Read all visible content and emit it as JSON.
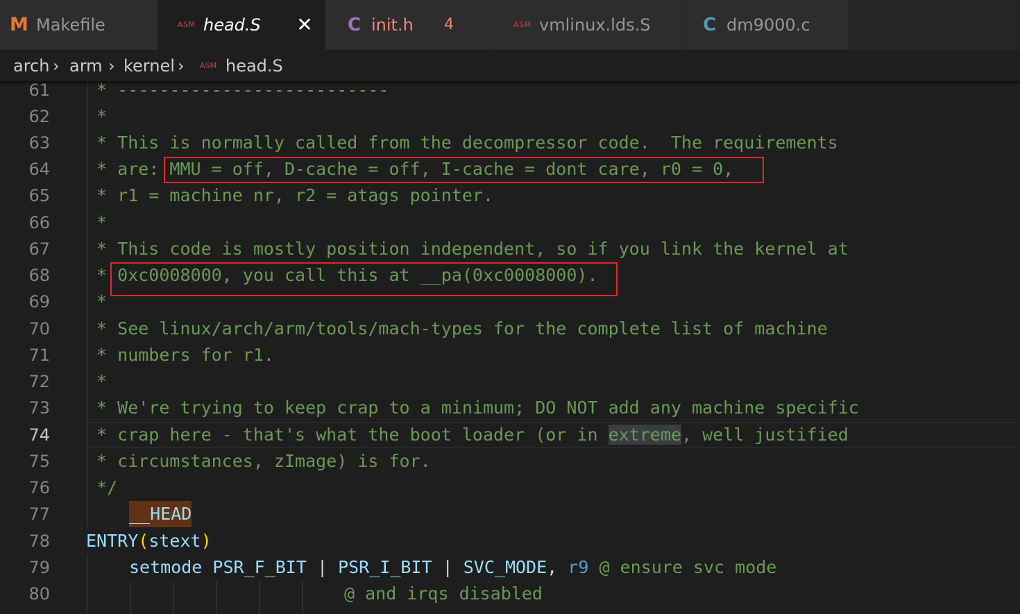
{
  "tabs": [
    {
      "icon": "M",
      "label": "Makefile"
    },
    {
      "icon": "ASM",
      "label": "head.S",
      "close": "✕"
    },
    {
      "icon": "C",
      "label": "init.h",
      "badge": "4"
    },
    {
      "icon": "ASM",
      "label": "vmlinux.lds.S"
    },
    {
      "icon": "C",
      "label": "dm9000.c"
    }
  ],
  "breadcrumb": {
    "parts": [
      "arch",
      "arm",
      "kernel"
    ],
    "file_icon": "ASM",
    "file": "head.S"
  },
  "editor": {
    "current_line": 74,
    "lines": [
      {
        "n": "61",
        "text": " * --------------------------"
      },
      {
        "n": "62",
        "text": " *"
      },
      {
        "n": "63",
        "text": " * This is normally called from the decompressor code.  The requirements"
      },
      {
        "n": "64",
        "text": " * are: MMU = off, D-cache = off, I-cache = dont care, r0 = 0,"
      },
      {
        "n": "65",
        "text": " * r1 = machine nr, r2 = atags pointer."
      },
      {
        "n": "66",
        "text": " *"
      },
      {
        "n": "67",
        "text": " * This code is mostly position independent, so if you link the kernel at"
      },
      {
        "n": "68",
        "text": " * 0xc0008000, you call this at __pa(0xc0008000)."
      },
      {
        "n": "69",
        "text": " *"
      },
      {
        "n": "70",
        "text": " * See linux/arch/arm/tools/mach-types for the complete list of machine"
      },
      {
        "n": "71",
        "text": " * numbers for r1."
      },
      {
        "n": "72",
        "text": " *"
      },
      {
        "n": "73",
        "text": " * We're trying to keep crap to a minimum; DO NOT add any machine specific"
      },
      {
        "n": "74",
        "text_pre": " * crap here - that's what the boot loader (or in ",
        "text_hl": "extreme",
        "text_post": ", well justified"
      },
      {
        "n": "75",
        "text": " * circumstances, zImage) is for."
      },
      {
        "n": "76",
        "text": " */"
      },
      {
        "n": "77",
        "text": "__HEAD"
      },
      {
        "n": "78",
        "entry": "ENTRY",
        "open": "(",
        "arg": "stext",
        "close": ")"
      },
      {
        "n": "79",
        "fn": "setmode",
        "a1": "PSR_F_BIT",
        "bar": "|",
        "a2": "PSR_I_BIT",
        "a3": "SVC_MODE",
        "comma": ",",
        "reg": "r9",
        "comment": "@ ensure svc mode"
      },
      {
        "n": "80",
        "comment": "@ and irqs disabled"
      }
    ]
  },
  "colors": {
    "comment": "#6a9955",
    "highlight_box": "#e3252c",
    "background": "#1e1e1e"
  }
}
